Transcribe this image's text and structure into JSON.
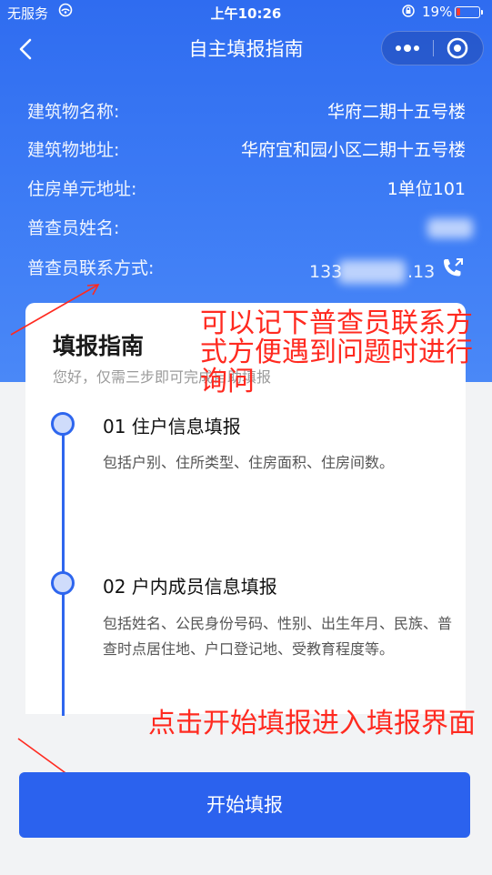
{
  "status_bar": {
    "carrier": "无服务",
    "time": "上午10:26",
    "battery_percent": "19%",
    "battery_level": 0.19,
    "battery_color": "#ff3b30"
  },
  "nav": {
    "title": "自主填报指南",
    "back_icon": "chevron-left-icon",
    "more_icon": "more-dots-icon",
    "close_icon": "target-circle-icon"
  },
  "info": {
    "rows": [
      {
        "label": "建筑物名称:",
        "value": "华府二期十五号楼"
      },
      {
        "label": "建筑物地址:",
        "value": "华府宜和园小区二期十五号楼"
      },
      {
        "label": "住房单元地址:",
        "value": "1单位101"
      },
      {
        "label": "普查员姓名:",
        "value": ""
      },
      {
        "label": "普查员联系方式:",
        "value_start": "133",
        "value_end": ".13"
      }
    ],
    "phone_icon": "phone-call-icon"
  },
  "guide": {
    "title": "填报指南",
    "subtitle": "您好，仅需三步即可完成自助填报",
    "steps": [
      {
        "title": "01 住户信息填报",
        "desc": "包括户别、住所类型、住房面积、住房间数。"
      },
      {
        "title": "02 户内成员信息填报",
        "desc": "包括姓名、公民身份号码、性别、出生年月、民族、普查时点居住地、户口登记地、受教育程度等。"
      }
    ]
  },
  "annotations": {
    "contact_note": "可以记下普查员联系方式方便遇到问题时进行询问",
    "start_note": "点击开始填报进入填报界面",
    "color": "#ff2a20"
  },
  "actions": {
    "start_label": "开始填报"
  },
  "colors": {
    "brand_blue": "#2f6cf0",
    "button_blue": "#2b62ee",
    "page_bg": "#f2f3f5"
  }
}
